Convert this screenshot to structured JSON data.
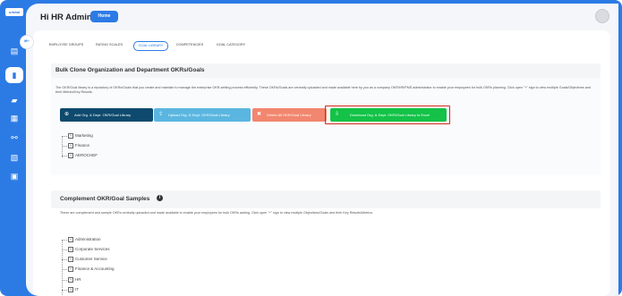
{
  "logo": {
    "text": "orbital"
  },
  "header": {
    "greeting": "Hi HR Admin",
    "home_label": "Home"
  },
  "sidebar": {
    "items": [
      {
        "name": "clipboard-icon",
        "glyph": "▤"
      },
      {
        "name": "book-icon",
        "glyph": "▮"
      },
      {
        "name": "briefcase-icon",
        "glyph": "▰"
      },
      {
        "name": "calendar-icon",
        "glyph": "▦"
      },
      {
        "name": "handshake-icon",
        "glyph": "⚯"
      },
      {
        "name": "document-icon",
        "glyph": "▧"
      },
      {
        "name": "report-icon",
        "glyph": "▣"
      }
    ],
    "collapse_glyph": "⇤"
  },
  "tabs": [
    {
      "label": "EMPLOYEE GROUPS"
    },
    {
      "label": "RATING SCALES"
    },
    {
      "label": "GOAL LIBRARY"
    },
    {
      "label": "COMPETENCIES"
    },
    {
      "label": "GOAL CATEGORY"
    }
  ],
  "bulk_section": {
    "title": "Bulk Clone Organization and Department OKRs/Goals",
    "description": "The OKR/Goal library is a repository of OKRs/Goals that you create and maintain to manage the enterprise OKR-setting process efficiently. These OKRs/Goals are centrally uploaded and made available here by you as a company OKR/HR/PMS administrator to enable your employees for bulk OKRs planning. Click open \"+\" sign to view multiple Goals/Objectives and their Metrics/Key Results.",
    "buttons": {
      "add": "Add Org. & Dept. OKR/Goal Library",
      "upload": "Upload Org. & Dept. OKR/Goal Library",
      "delete": "Delete All OKR/Goal Library",
      "download": "Download Org. & Dept. OKR/Goal Library to Excel"
    },
    "tree": [
      "Marketing",
      "Finance",
      "AEROCHEF"
    ]
  },
  "complement_section": {
    "title": "Complement OKR/Goal Samples",
    "info_glyph": "i",
    "description": "These are complement and sample OKRs centrally uploaded and made available to enable your employees for bulk OKRs adding. Click open \"+\" sign to view multiple Objectives/Goals and their Key Results/Metrics.",
    "tree": [
      "Administration",
      "Corporate Services",
      "Customer Service",
      "Finance & Accounting",
      "HR",
      "IT"
    ]
  },
  "colors": {
    "brand": "#2c7be5",
    "add_button": "#0e4a6e",
    "upload_button": "#5ab6e0",
    "delete_button": "#f2866e",
    "download_button": "#13c247",
    "highlight": "#d32a20"
  }
}
